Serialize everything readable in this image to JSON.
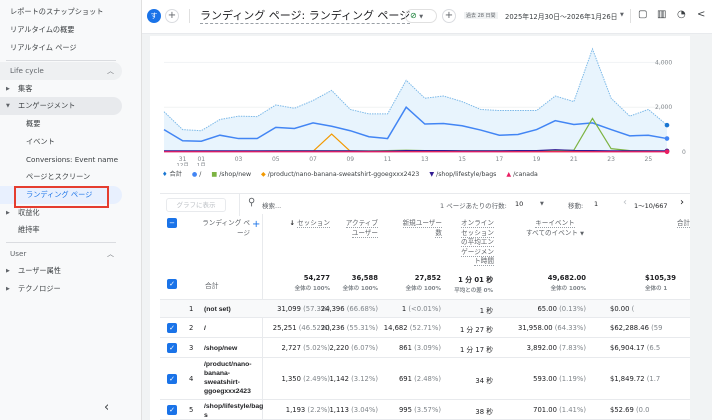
{
  "sidebar": {
    "items": [
      {
        "label": "レポートのスナップショット"
      },
      {
        "label": "リアルタイムの概要"
      },
      {
        "label": "リアルタイム ページ"
      },
      {
        "label": "Life cycle"
      },
      {
        "label": "集客"
      },
      {
        "label": "エンゲージメント"
      },
      {
        "label": "概要"
      },
      {
        "label": "イベント"
      },
      {
        "label": "Conversions: Event name"
      },
      {
        "label": "ページとスクリーン"
      },
      {
        "label": "ランディング ページ"
      },
      {
        "label": "収益化"
      },
      {
        "label": "維持率"
      },
      {
        "label": "User"
      },
      {
        "label": "ユーザー属性"
      },
      {
        "label": "テクノロジー"
      }
    ],
    "collapse": "‹"
  },
  "topbar": {
    "avatar": "す",
    "title": "ランディング ページ: ランディング ページ",
    "range_badge": "過去 28 日間",
    "date_range": "2025年12月30日～2026年1月26日"
  },
  "colors": {
    "accent": "#1a73e8",
    "total": "#7cb9e8",
    "root": "#4285f4",
    "shop_new": "#7cb342",
    "product": "#f29900",
    "bags": "#311b92",
    "canada": "#e91e63",
    "selected_box": "#e53d2f"
  },
  "chart_data": {
    "type": "line",
    "x": [
      "12/30",
      "12/31",
      "1/01",
      "1/02",
      "1/03",
      "1/04",
      "1/05",
      "1/06",
      "1/07",
      "1/08",
      "1/09",
      "1/10",
      "1/11",
      "1/12",
      "1/13",
      "1/14",
      "1/15",
      "1/16",
      "1/17",
      "1/18",
      "1/19",
      "1/20",
      "1/21",
      "1/22",
      "1/23",
      "1/24",
      "1/25",
      "1/26"
    ],
    "xtick_labels": [
      {
        "label": "31",
        "sub": "12月",
        "i": 1
      },
      {
        "label": "01",
        "sub": "1月",
        "i": 2
      },
      {
        "label": "03",
        "i": 4
      },
      {
        "label": "05",
        "i": 6
      },
      {
        "label": "07",
        "i": 8
      },
      {
        "label": "09",
        "i": 10
      },
      {
        "label": "11",
        "i": 12
      },
      {
        "label": "13",
        "i": 14
      },
      {
        "label": "15",
        "i": 16
      },
      {
        "label": "17",
        "i": 18
      },
      {
        "label": "19",
        "i": 20
      },
      {
        "label": "21",
        "i": 22
      },
      {
        "label": "23",
        "i": 24
      },
      {
        "label": "25",
        "i": 26
      }
    ],
    "yticks": [
      "0",
      "2,000",
      "4,000"
    ],
    "ylim": [
      0,
      5000
    ],
    "grid": true,
    "legend_position": "bottom",
    "series": [
      {
        "name": "合計",
        "key": "total",
        "values": [
          1800,
          1000,
          950,
          1450,
          1600,
          1580,
          2100,
          1950,
          2300,
          2750,
          1900,
          1700,
          1700,
          3200,
          2400,
          2500,
          2250,
          1900,
          1850,
          1850,
          1850,
          2500,
          2250,
          4600,
          2400,
          1600,
          1900,
          1200
        ]
      },
      {
        "name": "/",
        "key": "root",
        "values": [
          1000,
          500,
          480,
          750,
          600,
          600,
          1100,
          1050,
          1300,
          1150,
          950,
          680,
          600,
          2000,
          1250,
          1270,
          1170,
          980,
          750,
          780,
          1000,
          1400,
          1230,
          1300,
          1000,
          720,
          750,
          600
        ]
      },
      {
        "name": "/shop/new",
        "key": "shop_new",
        "values": [
          40,
          40,
          40,
          40,
          40,
          40,
          50,
          50,
          50,
          50,
          50,
          50,
          60,
          80,
          60,
          60,
          50,
          50,
          50,
          50,
          50,
          60,
          80,
          1500,
          150,
          60,
          50,
          40
        ]
      },
      {
        "name": "/product/nano-banana-sweatshirt-ggoegxxx2423",
        "key": "product",
        "values": [
          30,
          30,
          30,
          30,
          30,
          30,
          30,
          30,
          30,
          800,
          30,
          20,
          20,
          30,
          30,
          30,
          30,
          30,
          20,
          20,
          20,
          20,
          20,
          20,
          20,
          20,
          20,
          20
        ]
      },
      {
        "name": "/shop/lifestyle/bags",
        "key": "bags",
        "values": [
          50,
          50,
          50,
          50,
          50,
          50,
          50,
          50,
          50,
          50,
          50,
          40,
          40,
          60,
          60,
          60,
          50,
          50,
          50,
          60,
          60,
          100,
          70,
          60,
          50,
          50,
          50,
          50
        ]
      },
      {
        "name": "/canada",
        "key": "canada",
        "values": [
          10,
          10,
          10,
          10,
          10,
          10,
          10,
          10,
          10,
          10,
          10,
          10,
          10,
          10,
          10,
          10,
          10,
          10,
          10,
          10,
          10,
          10,
          10,
          10,
          10,
          10,
          10,
          10
        ]
      }
    ]
  },
  "toolbar": {
    "graph_button": "グラフに表示",
    "search_placeholder": "検索...",
    "rows_label": "1 ページあたりの行数:",
    "rows_value": "10",
    "goto_label": "移動:",
    "goto_value": "1",
    "range": "1～10/667"
  },
  "table": {
    "headers": {
      "landing": "ランディング ページ",
      "sessions": "セッション",
      "active_users": "アクティブ ユーザー",
      "new_users": "新規ユーザー数",
      "engagement": "オンライン セッションの平均エンゲージメント時間",
      "key_events": "キーイベント",
      "key_events_sub": "すべてのイベント",
      "revenue": "合計"
    },
    "total": {
      "label": "合計",
      "sessions": "54,277",
      "sessions_sub": "全体の 100%",
      "active_users": "36,588",
      "active_users_sub": "全体の 100%",
      "new_users": "27,852",
      "new_users_sub": "全体の 100%",
      "engagement": "1 分 01 秒",
      "engagement_sub": "平均との差 0%",
      "key_events": "49,682.00",
      "key_events_sub": "全体の 100%",
      "revenue": "$105,39",
      "revenue_sub": "全体の 1"
    },
    "rows": [
      {
        "rank": "1",
        "page": "(not set)",
        "checked": false,
        "sessions": "31,099",
        "sessions_pct": "(57.3%)",
        "active": "24,396",
        "active_pct": "(66.68%)",
        "new": "1",
        "new_pct": "(<0.01%)",
        "eng": "1 秒",
        "key": "65.00",
        "key_pct": "(0.13%)",
        "rev": "$0.00",
        "rev_pct": "("
      },
      {
        "rank": "2",
        "page": "/",
        "checked": true,
        "sessions": "25,251",
        "sessions_pct": "(46.52%)",
        "active": "20,236",
        "active_pct": "(55.31%)",
        "new": "14,682",
        "new_pct": "(52.71%)",
        "eng": "1 分 27 秒",
        "key": "31,958.00",
        "key_pct": "(64.33%)",
        "rev": "$62,288.46",
        "rev_pct": "(59"
      },
      {
        "rank": "3",
        "page": "/shop/new",
        "checked": true,
        "sessions": "2,727",
        "sessions_pct": "(5.02%)",
        "active": "2,220",
        "active_pct": "(6.07%)",
        "new": "861",
        "new_pct": "(3.09%)",
        "eng": "1 分 17 秒",
        "key": "3,892.00",
        "key_pct": "(7.83%)",
        "rev": "$6,904.17",
        "rev_pct": "(6.5"
      },
      {
        "rank": "4",
        "page": "/product/nano-banana-sweatshirt-ggoegxxx2423",
        "checked": true,
        "sessions": "1,350",
        "sessions_pct": "(2.49%)",
        "active": "1,142",
        "active_pct": "(3.12%)",
        "new": "691",
        "new_pct": "(2.48%)",
        "eng": "34 秒",
        "key": "593.00",
        "key_pct": "(1.19%)",
        "rev": "$1,849.72",
        "rev_pct": "(1.7"
      },
      {
        "rank": "5",
        "page": "/shop/lifestyle/bags",
        "checked": true,
        "sessions": "1,193",
        "sessions_pct": "(2.2%)",
        "active": "1,113",
        "active_pct": "(3.04%)",
        "new": "995",
        "new_pct": "(3.57%)",
        "eng": "38 秒",
        "key": "701.00",
        "key_pct": "(1.41%)",
        "rev": "$52.69",
        "rev_pct": "(0.0"
      }
    ]
  }
}
